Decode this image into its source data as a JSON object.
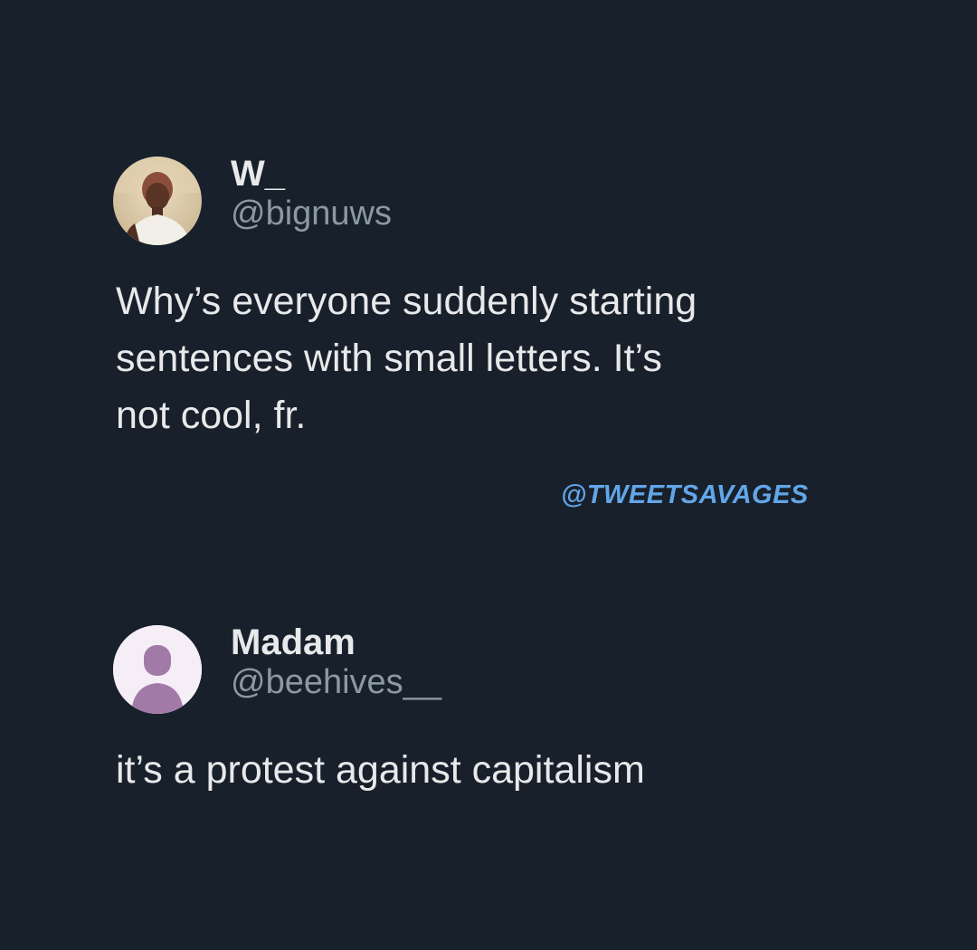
{
  "tweets": [
    {
      "display_name": "W_",
      "handle": "@bignuws",
      "text": "Why’s everyone suddenly starting\nsentences with small letters. It’s\nnot cool, fr.",
      "avatar": "profile-photo"
    },
    {
      "display_name": "Madam",
      "handle": "@beehives__",
      "text": "it’s a protest against capitalism",
      "avatar": "default-profile-icon"
    }
  ],
  "watermark": "@TWEETSAVAGES",
  "colors": {
    "background": "#18202b",
    "text_primary": "#e7e9ea",
    "text_secondary": "#8b98a5",
    "watermark": "#62a6e8",
    "default_avatar_bg": "#f6eef7",
    "default_avatar_fg": "#a27aa8"
  }
}
